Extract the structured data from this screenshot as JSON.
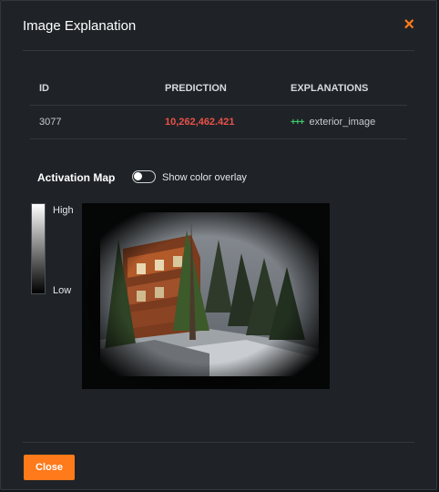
{
  "dialog": {
    "title": "Image Explanation"
  },
  "table": {
    "headers": {
      "id": "ID",
      "prediction": "PREDICTION",
      "explanations": "EXPLANATIONS"
    },
    "row": {
      "id": "3077",
      "prediction": "10,262,462.421",
      "explanation_strength": "+++",
      "explanation_feature": "exterior_image"
    }
  },
  "activation": {
    "title": "Activation Map",
    "overlay_toggle_label": "Show color overlay",
    "overlay_enabled": false,
    "legend_high": "High",
    "legend_low": "Low"
  },
  "footer": {
    "close_label": "Close"
  },
  "colors": {
    "accent": "#ff7a1a",
    "prediction": "#ea5149",
    "positive": "#3ec96b",
    "background": "#1f2327"
  },
  "icons": {
    "close": "close-icon"
  }
}
